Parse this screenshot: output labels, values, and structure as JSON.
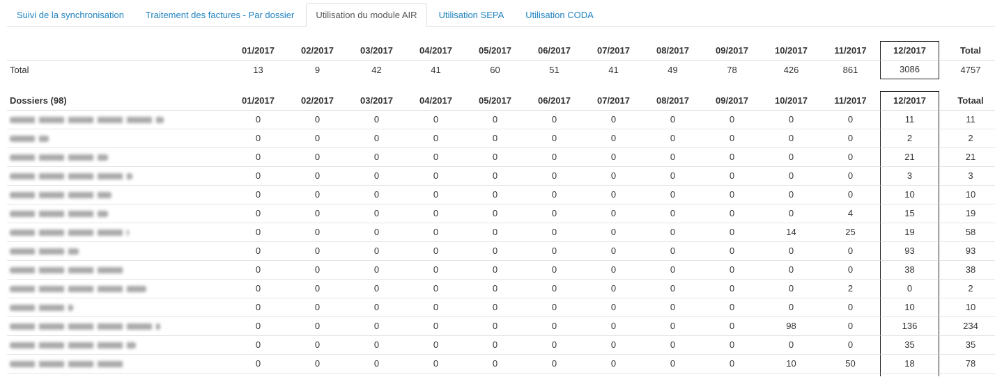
{
  "tabs": [
    {
      "label": "Suivi de la synchronisation",
      "active": false
    },
    {
      "label": "Traitement des factures - Par dossier",
      "active": false
    },
    {
      "label": "Utilisation du module AIR",
      "active": true
    },
    {
      "label": "Utilisation SEPA",
      "active": false
    },
    {
      "label": "Utilisation CODA",
      "active": false
    }
  ],
  "summary_table": {
    "columns": [
      {
        "label": "01/2017",
        "highlighted": false
      },
      {
        "label": "02/2017",
        "highlighted": false
      },
      {
        "label": "03/2017",
        "highlighted": false
      },
      {
        "label": "04/2017",
        "highlighted": false
      },
      {
        "label": "05/2017",
        "highlighted": false
      },
      {
        "label": "06/2017",
        "highlighted": false
      },
      {
        "label": "07/2017",
        "highlighted": false
      },
      {
        "label": "08/2017",
        "highlighted": false
      },
      {
        "label": "09/2017",
        "highlighted": false
      },
      {
        "label": "10/2017",
        "highlighted": false
      },
      {
        "label": "11/2017",
        "highlighted": false
      },
      {
        "label": "12/2017",
        "highlighted": true
      }
    ],
    "total_label": "Total",
    "row": {
      "label": "Total",
      "values": [
        13,
        9,
        42,
        41,
        60,
        51,
        41,
        49,
        78,
        426,
        861,
        3086
      ],
      "total": 4757
    }
  },
  "dossiers_table": {
    "header_label": "Dossiers (98)",
    "columns": [
      {
        "label": "01/2017",
        "highlighted": false
      },
      {
        "label": "02/2017",
        "highlighted": false
      },
      {
        "label": "03/2017",
        "highlighted": false
      },
      {
        "label": "04/2017",
        "highlighted": false
      },
      {
        "label": "05/2017",
        "highlighted": false
      },
      {
        "label": "06/2017",
        "highlighted": false
      },
      {
        "label": "07/2017",
        "highlighted": false
      },
      {
        "label": "08/2017",
        "highlighted": false
      },
      {
        "label": "09/2017",
        "highlighted": false
      },
      {
        "label": "10/2017",
        "highlighted": false
      },
      {
        "label": "11/2017",
        "highlighted": false
      },
      {
        "label": "12/2017",
        "highlighted": true
      }
    ],
    "total_label": "Totaal",
    "rows": [
      {
        "values": [
          0,
          0,
          0,
          0,
          0,
          0,
          0,
          0,
          0,
          0,
          0,
          11
        ],
        "total": 11
      },
      {
        "values": [
          0,
          0,
          0,
          0,
          0,
          0,
          0,
          0,
          0,
          0,
          0,
          2
        ],
        "total": 2
      },
      {
        "values": [
          0,
          0,
          0,
          0,
          0,
          0,
          0,
          0,
          0,
          0,
          0,
          21
        ],
        "total": 21
      },
      {
        "values": [
          0,
          0,
          0,
          0,
          0,
          0,
          0,
          0,
          0,
          0,
          0,
          3
        ],
        "total": 3
      },
      {
        "values": [
          0,
          0,
          0,
          0,
          0,
          0,
          0,
          0,
          0,
          0,
          0,
          10
        ],
        "total": 10
      },
      {
        "values": [
          0,
          0,
          0,
          0,
          0,
          0,
          0,
          0,
          0,
          0,
          4,
          15
        ],
        "total": 19
      },
      {
        "values": [
          0,
          0,
          0,
          0,
          0,
          0,
          0,
          0,
          0,
          14,
          25,
          19
        ],
        "total": 58
      },
      {
        "values": [
          0,
          0,
          0,
          0,
          0,
          0,
          0,
          0,
          0,
          0,
          0,
          93
        ],
        "total": 93
      },
      {
        "values": [
          0,
          0,
          0,
          0,
          0,
          0,
          0,
          0,
          0,
          0,
          0,
          38
        ],
        "total": 38
      },
      {
        "values": [
          0,
          0,
          0,
          0,
          0,
          0,
          0,
          0,
          0,
          0,
          2,
          0
        ],
        "total": 2
      },
      {
        "values": [
          0,
          0,
          0,
          0,
          0,
          0,
          0,
          0,
          0,
          0,
          0,
          10
        ],
        "total": 10
      },
      {
        "values": [
          0,
          0,
          0,
          0,
          0,
          0,
          0,
          0,
          0,
          98,
          0,
          136
        ],
        "total": 234
      },
      {
        "values": [
          0,
          0,
          0,
          0,
          0,
          0,
          0,
          0,
          0,
          0,
          0,
          35
        ],
        "total": 35
      },
      {
        "values": [
          0,
          0,
          0,
          0,
          0,
          0,
          0,
          0,
          0,
          10,
          50,
          18
        ],
        "total": 78
      }
    ]
  },
  "colors": {
    "tab_link": "#1f82c0",
    "active_tab_text": "#555555",
    "text": "#333333",
    "divider": "#dddddd",
    "row_border": "#e5e5e5",
    "highlight_border": "#222222"
  }
}
